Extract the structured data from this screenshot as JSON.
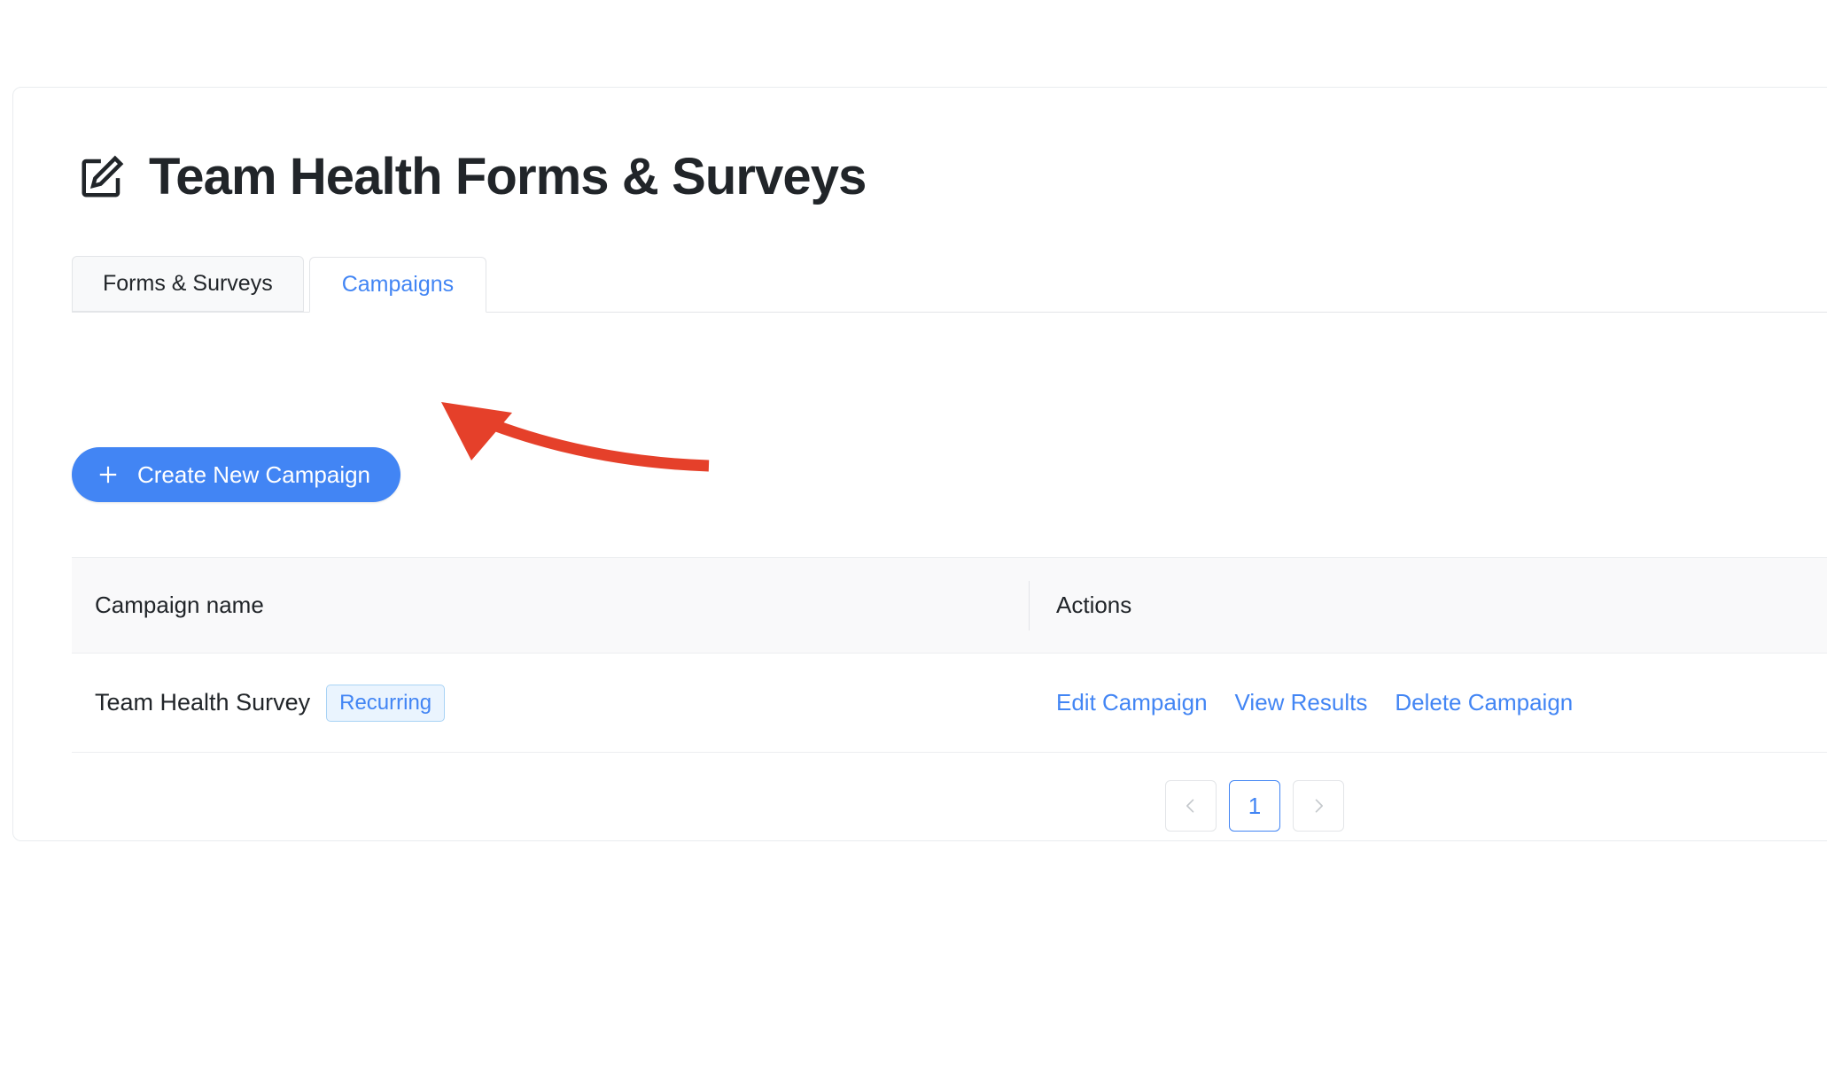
{
  "header": {
    "title": "Team Health Forms & Surveys",
    "title_icon": "edit-square-icon"
  },
  "tabs": [
    {
      "label": "Forms & Surveys",
      "active": false
    },
    {
      "label": "Campaigns",
      "active": true
    }
  ],
  "toolbar": {
    "create_label": "Create New Campaign",
    "create_icon": "plus-icon"
  },
  "table": {
    "columns": [
      "Campaign name",
      "Actions"
    ],
    "rows": [
      {
        "name": "Team Health Survey",
        "badge": "Recurring",
        "actions": [
          "Edit Campaign",
          "View Results",
          "Delete Campaign"
        ]
      }
    ]
  },
  "pagination": {
    "prev_icon": "chevron-left-icon",
    "next_icon": "chevron-right-icon",
    "pages": [
      "1"
    ],
    "current_page": "1"
  },
  "annotation": {
    "type": "curved-arrow",
    "color": "#e5402a",
    "points_to": "create-new-campaign-button"
  },
  "colors": {
    "accent_blue": "#4285f4",
    "text_dark": "#212529",
    "border_gray": "#e3e5e8",
    "header_band": "#f9f9fa",
    "badge_bg": "#eaf4fe",
    "badge_border": "#a9d3f5",
    "annotation_red": "#e5402a"
  }
}
